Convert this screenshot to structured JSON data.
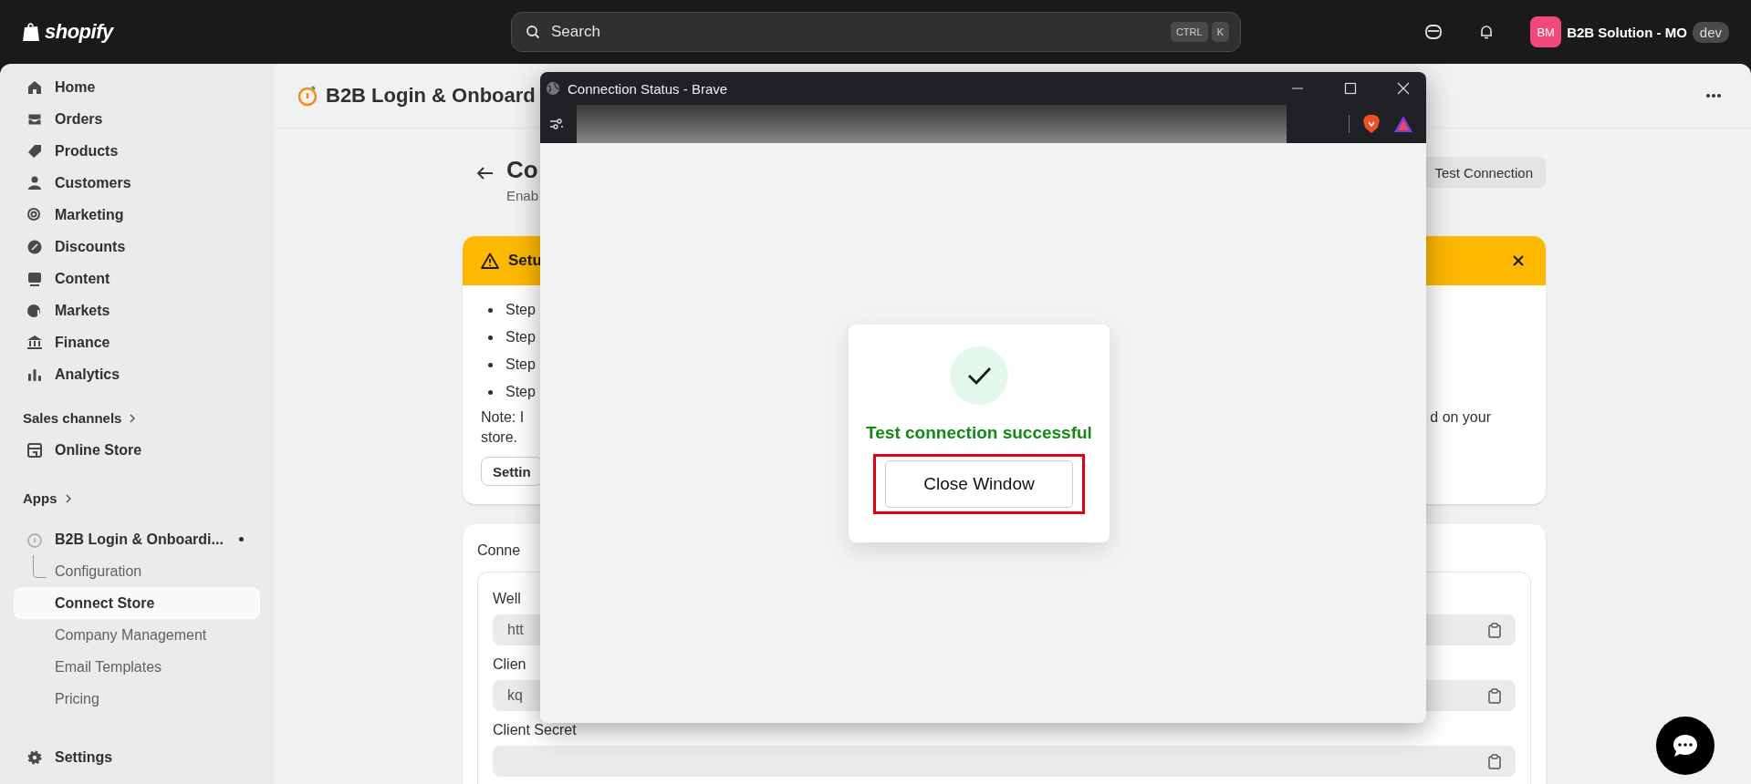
{
  "topbar": {
    "logo": "shopify",
    "search": {
      "placeholder": "Search",
      "keys": [
        "CTRL",
        "K"
      ]
    },
    "store": {
      "initials": "BM",
      "name": "B2B Solution - MO",
      "badge": "dev"
    }
  },
  "sidebar": {
    "items": [
      {
        "label": "Home",
        "selected": false
      },
      {
        "label": "Orders",
        "selected": false
      },
      {
        "label": "Products",
        "selected": false
      },
      {
        "label": "Customers",
        "selected": false
      },
      {
        "label": "Marketing",
        "selected": false
      },
      {
        "label": "Discounts",
        "selected": false
      },
      {
        "label": "Content",
        "selected": false
      },
      {
        "label": "Markets",
        "selected": false
      },
      {
        "label": "Finance",
        "selected": false
      },
      {
        "label": "Analytics",
        "selected": false
      }
    ],
    "sales_channels": {
      "label": "Sales channels",
      "items": [
        {
          "label": "Online Store",
          "selected": false
        }
      ]
    },
    "apps": {
      "label": "Apps",
      "app": {
        "label": "B2B Login & Onboardi...",
        "children": [
          {
            "label": "Configuration",
            "selected": false
          },
          {
            "label": "Connect Store",
            "selected": true
          },
          {
            "label": "Company Management",
            "selected": false
          },
          {
            "label": "Email Templates",
            "selected": false
          },
          {
            "label": "Pricing",
            "selected": false
          }
        ]
      }
    },
    "settings": "Settings"
  },
  "page": {
    "app_title": "B2B Login & Onboard",
    "title": "Co",
    "subtitle": "Enab",
    "test_button": "Test Connection",
    "banner": {
      "title": "Setu",
      "steps": [
        "Step",
        "Step",
        "Step",
        "Step"
      ],
      "note_left": "Note: I",
      "note_right": "d on your",
      "note_end": "store.",
      "button": "Settin"
    },
    "connect_card": {
      "title": "Conne",
      "fields": [
        {
          "label": "Well",
          "value": "htt"
        },
        {
          "label": "Clien",
          "value": "kq"
        },
        {
          "label": "Client Secret"
        }
      ]
    }
  },
  "popup": {
    "title": "Connection Status - Brave",
    "message": "Test connection successful",
    "button": "Close Window"
  }
}
